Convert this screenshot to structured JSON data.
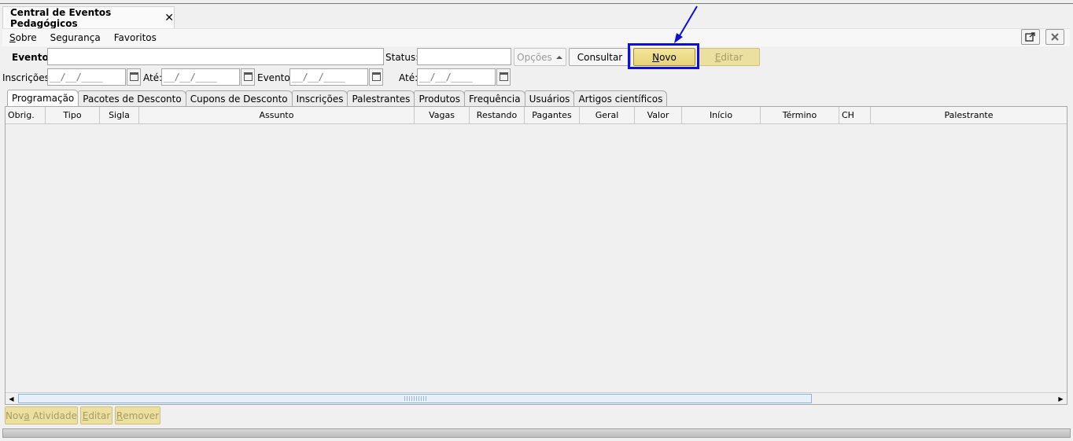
{
  "window": {
    "tab_title": "Central de Eventos Pedagógicos",
    "close_glyph": "✕"
  },
  "menu": {
    "items": [
      {
        "pre": "",
        "accel": "S",
        "post": "obre"
      },
      {
        "pre": "Segurança",
        "accel": "",
        "post": ""
      },
      {
        "pre": "Favoritos",
        "accel": "",
        "post": ""
      }
    ]
  },
  "filters": {
    "evento_label": "Evento:",
    "evento_value": "",
    "status_label": "Status:",
    "status_value": "",
    "opcoes_label": "Opções",
    "consultar_label": "Consultar",
    "novo_accel": "N",
    "novo_rest": "ovo",
    "editar_accel": "E",
    "editar_rest": "ditar",
    "inscricoes_label": "Inscrições:",
    "ate1_label": "Até:",
    "evento_date_label": "Evento:",
    "ate2_label": "Até:",
    "date_mask": "__/__/____ __:__"
  },
  "tabs": [
    "Programação",
    "Pacotes de Desconto",
    "Cupons de Desconto",
    "Inscrições",
    "Palestrantes",
    "Produtos",
    "Frequência",
    "Usuários",
    "Artigos científicos"
  ],
  "table": {
    "columns": [
      "Obrig.",
      "Tipo",
      "Sigla",
      "Assunto",
      "Vagas",
      "Restando",
      "Pagantes",
      "Geral",
      "Valor",
      "Início",
      "Término",
      "CH",
      "Palestrante"
    ]
  },
  "actions": {
    "nova_pre": "Nov",
    "nova_accel": "a",
    "nova_post": " Atividade",
    "editar_accel": "E",
    "editar_rest": "ditar",
    "remover_accel": "R",
    "remover_rest": "emover"
  },
  "colors": {
    "highlight": "#0c10d8",
    "gold_button": "#e6d37a"
  },
  "icons": [
    "close-icon",
    "popout-icon",
    "window-close-icon",
    "calendar-icon",
    "triangle-up-icon",
    "arrow-icon",
    "scroll-left-icon",
    "scroll-right-icon"
  ]
}
